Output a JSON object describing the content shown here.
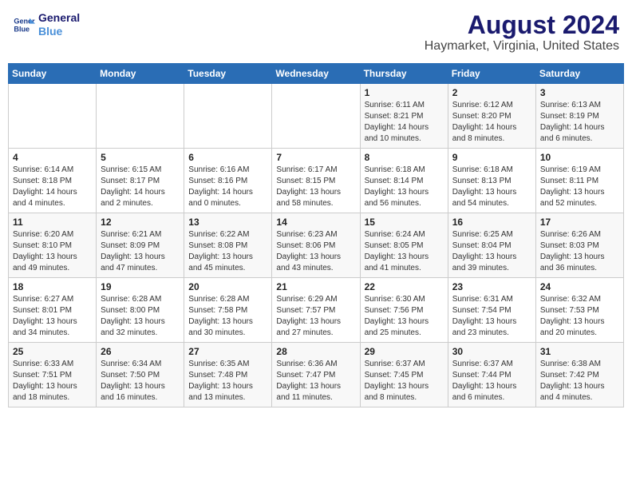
{
  "header": {
    "logo_line1": "General",
    "logo_line2": "Blue",
    "title": "August 2024",
    "subtitle": "Haymarket, Virginia, United States"
  },
  "days_of_week": [
    "Sunday",
    "Monday",
    "Tuesday",
    "Wednesday",
    "Thursday",
    "Friday",
    "Saturday"
  ],
  "weeks": [
    [
      {
        "num": "",
        "info": ""
      },
      {
        "num": "",
        "info": ""
      },
      {
        "num": "",
        "info": ""
      },
      {
        "num": "",
        "info": ""
      },
      {
        "num": "1",
        "info": "Sunrise: 6:11 AM\nSunset: 8:21 PM\nDaylight: 14 hours\nand 10 minutes."
      },
      {
        "num": "2",
        "info": "Sunrise: 6:12 AM\nSunset: 8:20 PM\nDaylight: 14 hours\nand 8 minutes."
      },
      {
        "num": "3",
        "info": "Sunrise: 6:13 AM\nSunset: 8:19 PM\nDaylight: 14 hours\nand 6 minutes."
      }
    ],
    [
      {
        "num": "4",
        "info": "Sunrise: 6:14 AM\nSunset: 8:18 PM\nDaylight: 14 hours\nand 4 minutes."
      },
      {
        "num": "5",
        "info": "Sunrise: 6:15 AM\nSunset: 8:17 PM\nDaylight: 14 hours\nand 2 minutes."
      },
      {
        "num": "6",
        "info": "Sunrise: 6:16 AM\nSunset: 8:16 PM\nDaylight: 14 hours\nand 0 minutes."
      },
      {
        "num": "7",
        "info": "Sunrise: 6:17 AM\nSunset: 8:15 PM\nDaylight: 13 hours\nand 58 minutes."
      },
      {
        "num": "8",
        "info": "Sunrise: 6:18 AM\nSunset: 8:14 PM\nDaylight: 13 hours\nand 56 minutes."
      },
      {
        "num": "9",
        "info": "Sunrise: 6:18 AM\nSunset: 8:13 PM\nDaylight: 13 hours\nand 54 minutes."
      },
      {
        "num": "10",
        "info": "Sunrise: 6:19 AM\nSunset: 8:11 PM\nDaylight: 13 hours\nand 52 minutes."
      }
    ],
    [
      {
        "num": "11",
        "info": "Sunrise: 6:20 AM\nSunset: 8:10 PM\nDaylight: 13 hours\nand 49 minutes."
      },
      {
        "num": "12",
        "info": "Sunrise: 6:21 AM\nSunset: 8:09 PM\nDaylight: 13 hours\nand 47 minutes."
      },
      {
        "num": "13",
        "info": "Sunrise: 6:22 AM\nSunset: 8:08 PM\nDaylight: 13 hours\nand 45 minutes."
      },
      {
        "num": "14",
        "info": "Sunrise: 6:23 AM\nSunset: 8:06 PM\nDaylight: 13 hours\nand 43 minutes."
      },
      {
        "num": "15",
        "info": "Sunrise: 6:24 AM\nSunset: 8:05 PM\nDaylight: 13 hours\nand 41 minutes."
      },
      {
        "num": "16",
        "info": "Sunrise: 6:25 AM\nSunset: 8:04 PM\nDaylight: 13 hours\nand 39 minutes."
      },
      {
        "num": "17",
        "info": "Sunrise: 6:26 AM\nSunset: 8:03 PM\nDaylight: 13 hours\nand 36 minutes."
      }
    ],
    [
      {
        "num": "18",
        "info": "Sunrise: 6:27 AM\nSunset: 8:01 PM\nDaylight: 13 hours\nand 34 minutes."
      },
      {
        "num": "19",
        "info": "Sunrise: 6:28 AM\nSunset: 8:00 PM\nDaylight: 13 hours\nand 32 minutes."
      },
      {
        "num": "20",
        "info": "Sunrise: 6:28 AM\nSunset: 7:58 PM\nDaylight: 13 hours\nand 30 minutes."
      },
      {
        "num": "21",
        "info": "Sunrise: 6:29 AM\nSunset: 7:57 PM\nDaylight: 13 hours\nand 27 minutes."
      },
      {
        "num": "22",
        "info": "Sunrise: 6:30 AM\nSunset: 7:56 PM\nDaylight: 13 hours\nand 25 minutes."
      },
      {
        "num": "23",
        "info": "Sunrise: 6:31 AM\nSunset: 7:54 PM\nDaylight: 13 hours\nand 23 minutes."
      },
      {
        "num": "24",
        "info": "Sunrise: 6:32 AM\nSunset: 7:53 PM\nDaylight: 13 hours\nand 20 minutes."
      }
    ],
    [
      {
        "num": "25",
        "info": "Sunrise: 6:33 AM\nSunset: 7:51 PM\nDaylight: 13 hours\nand 18 minutes."
      },
      {
        "num": "26",
        "info": "Sunrise: 6:34 AM\nSunset: 7:50 PM\nDaylight: 13 hours\nand 16 minutes."
      },
      {
        "num": "27",
        "info": "Sunrise: 6:35 AM\nSunset: 7:48 PM\nDaylight: 13 hours\nand 13 minutes."
      },
      {
        "num": "28",
        "info": "Sunrise: 6:36 AM\nSunset: 7:47 PM\nDaylight: 13 hours\nand 11 minutes."
      },
      {
        "num": "29",
        "info": "Sunrise: 6:37 AM\nSunset: 7:45 PM\nDaylight: 13 hours\nand 8 minutes."
      },
      {
        "num": "30",
        "info": "Sunrise: 6:37 AM\nSunset: 7:44 PM\nDaylight: 13 hours\nand 6 minutes."
      },
      {
        "num": "31",
        "info": "Sunrise: 6:38 AM\nSunset: 7:42 PM\nDaylight: 13 hours\nand 4 minutes."
      }
    ]
  ]
}
